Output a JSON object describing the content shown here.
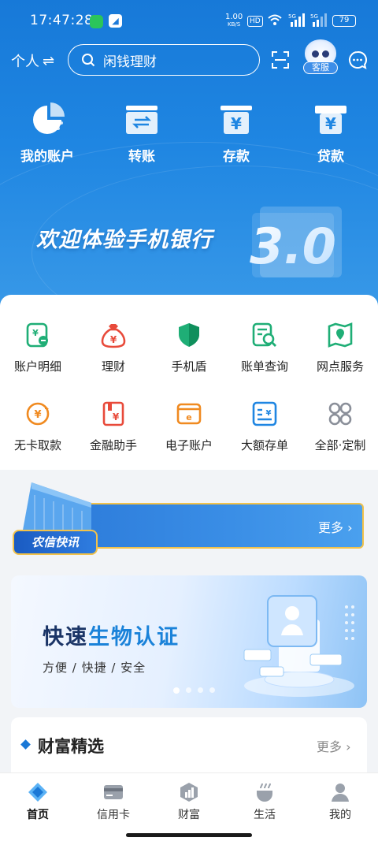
{
  "status_bar": {
    "time": "17:47:28",
    "net_speed_value": "1.00",
    "net_speed_unit": "KB/S",
    "hd_label": "HD",
    "battery": "79"
  },
  "topbar": {
    "account_switch_label": "个人",
    "swap_symbol": "⇌",
    "search_placeholder": "闲钱理财",
    "service_label": "客服"
  },
  "quick_actions": [
    {
      "label": "我的账户",
      "icon": "account-pie-icon"
    },
    {
      "label": "转账",
      "icon": "transfer-icon"
    },
    {
      "label": "存款",
      "icon": "deposit-icon"
    },
    {
      "label": "贷款",
      "icon": "loan-icon"
    }
  ],
  "banner": {
    "title": "欢迎体验手机银行",
    "version": "3.0"
  },
  "services": [
    {
      "label": "账户明细",
      "icon": "account-detail-icon"
    },
    {
      "label": "理财",
      "icon": "money-bag-icon"
    },
    {
      "label": "手机盾",
      "icon": "shield-icon"
    },
    {
      "label": "账单查询",
      "icon": "bill-search-icon"
    },
    {
      "label": "网点服务",
      "icon": "map-pin-icon"
    },
    {
      "label": "无卡取款",
      "icon": "cardless-withdraw-icon"
    },
    {
      "label": "金融助手",
      "icon": "finance-assistant-icon"
    },
    {
      "label": "电子账户",
      "icon": "e-account-icon"
    },
    {
      "label": "大额存单",
      "icon": "large-deposit-icon"
    },
    {
      "label": "全部·定制",
      "icon": "all-grid-icon"
    }
  ],
  "news": {
    "badge": "农信快讯",
    "more": "更多"
  },
  "bio_banner": {
    "title_prefix": "快速",
    "title_highlight": "生物认证",
    "subtitle": "方便  /  快捷  /  安全"
  },
  "wealth": {
    "title": "财富精选",
    "more": "更多"
  },
  "bottom_nav": [
    {
      "label": "首页",
      "icon": "home-icon",
      "active": true
    },
    {
      "label": "信用卡",
      "icon": "credit-card-icon",
      "active": false
    },
    {
      "label": "财富",
      "icon": "wealth-icon",
      "active": false
    },
    {
      "label": "生活",
      "icon": "life-icon",
      "active": false
    },
    {
      "label": "我的",
      "icon": "profile-icon",
      "active": false
    }
  ],
  "colors": {
    "primary": "#1f86e2",
    "accent_gold": "#f2c24a",
    "icon_green": "#1fae76",
    "icon_red": "#e84a3a",
    "icon_orange": "#f08a20"
  }
}
